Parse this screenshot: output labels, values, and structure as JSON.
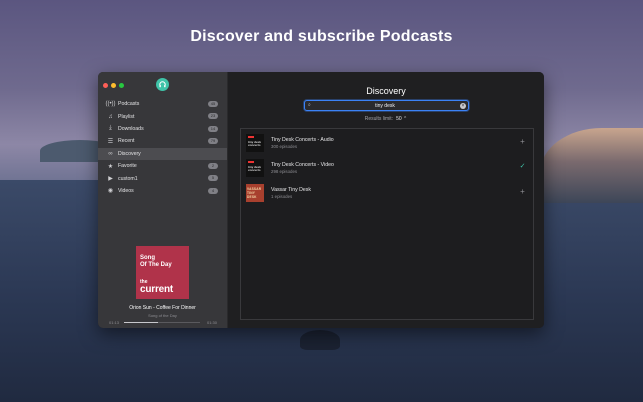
{
  "banner": {
    "title": "Discover and subscribe Podcasts"
  },
  "colors": {
    "accent": "#3fc3a8",
    "focus": "#3b82f6",
    "cover": "#b0334a"
  },
  "window": {
    "traffic_lights": [
      "#fe5f57",
      "#febc2e",
      "#28c840"
    ]
  },
  "sidebar": {
    "items": [
      {
        "label": "Podcasts",
        "icon": "podcast-icon",
        "badge": "45"
      },
      {
        "label": "Playlist",
        "icon": "playlist-icon",
        "badge": "23"
      },
      {
        "label": "Downloads",
        "icon": "download-icon",
        "badge": "14"
      },
      {
        "label": "Recent",
        "icon": "list-icon",
        "badge": "79"
      },
      {
        "label": "Discovery",
        "icon": "binoculars-icon",
        "badge": ""
      },
      {
        "label": "Favorite",
        "icon": "star-icon",
        "badge": "2"
      },
      {
        "label": "custom1",
        "icon": "play-circle-icon",
        "badge": "5"
      },
      {
        "label": "Videos",
        "icon": "video-circle-icon",
        "badge": "4"
      }
    ],
    "active": "Discovery"
  },
  "now_playing": {
    "cover": {
      "line1": "Song",
      "line2": "Of The Day",
      "line3": "the",
      "line4": "current"
    },
    "title": "Orion Sun - Coffee For Dinner",
    "subtitle": "Song of the Day",
    "elapsed": "01:13",
    "remaining": "01:30",
    "progress": 0.45
  },
  "main": {
    "title": "Discovery",
    "search": {
      "value": "tiny desk",
      "placeholder": ""
    },
    "limit": {
      "label": "Results limit:",
      "value": "50"
    },
    "results": [
      {
        "title": "Tiny Desk Concerts - Audio",
        "episodes": "300 episodes",
        "thumb": "npr",
        "thumb_text": "tiny desk concerts",
        "subscribed": false
      },
      {
        "title": "Tiny Desk Concerts - Video",
        "episodes": "298 episodes",
        "thumb": "npr",
        "thumb_text": "tiny desk concerts",
        "subscribed": true
      },
      {
        "title": "Vassar Tiny Desk",
        "episodes": "1 episodes",
        "thumb": "vassar",
        "thumb_text": "VASSAR TINY DESK",
        "subscribed": false
      }
    ]
  }
}
